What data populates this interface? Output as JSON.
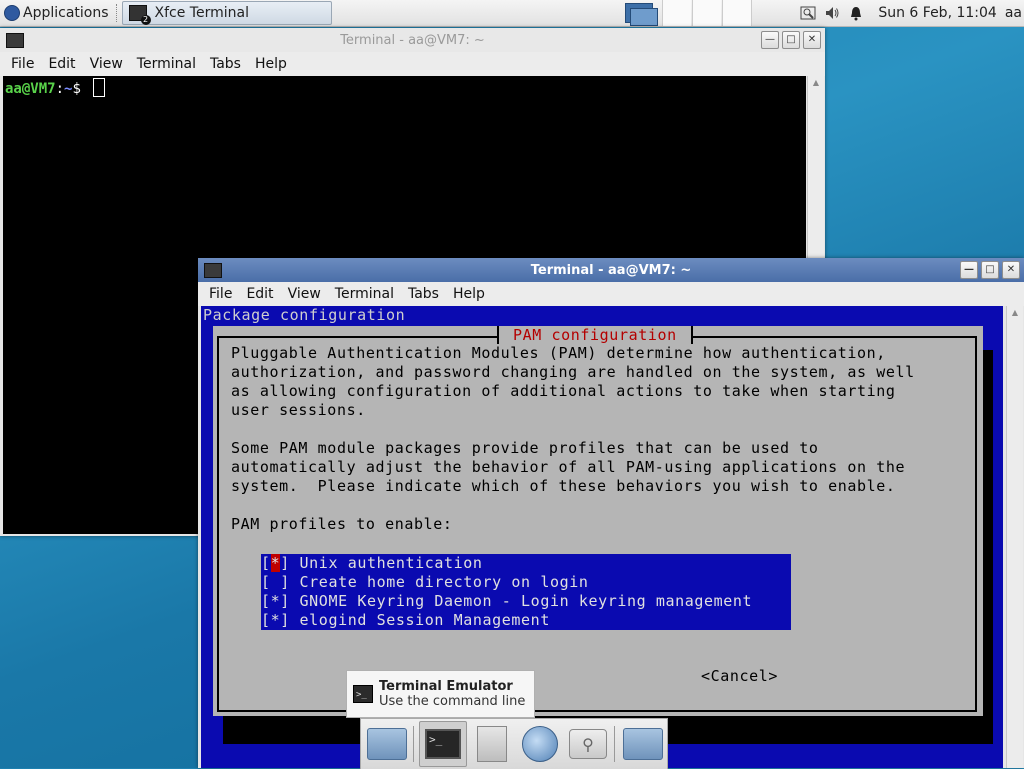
{
  "panel": {
    "applications_label": "Applications",
    "task_label": "Xfce Terminal",
    "task_badge": "2",
    "clock": "Sun  6 Feb, 11:04",
    "user": "aa"
  },
  "window_back": {
    "title": "Terminal - aa@VM7: ~",
    "menu": [
      "File",
      "Edit",
      "View",
      "Terminal",
      "Tabs",
      "Help"
    ],
    "prompt_user": "aa@VM7",
    "prompt_sep": ":",
    "prompt_path": "~",
    "prompt_symbol": "$"
  },
  "window_front": {
    "title": "Terminal - aa@VM7: ~",
    "menu": [
      "File",
      "Edit",
      "View",
      "Terminal",
      "Tabs",
      "Help"
    ],
    "package_config_label": "Package configuration",
    "dialog": {
      "title": "PAM configuration",
      "para1": [
        "Pluggable Authentication Modules (PAM) determine how authentication,",
        "authorization, and password changing are handled on the system, as well",
        "as allowing configuration of additional actions to take when starting",
        "user sessions."
      ],
      "para2": [
        "Some PAM module packages provide profiles that can be used to",
        "automatically adjust the behavior of all PAM-using applications on the",
        "system.  Please indicate which of these behaviors you wish to enable."
      ],
      "prompt": "PAM profiles to enable:",
      "options": [
        {
          "mark": "*",
          "label": "Unix authentication"
        },
        {
          "mark": " ",
          "label": "Create home directory on login"
        },
        {
          "mark": "*",
          "label": "GNOME Keyring Daemon - Login keyring management"
        },
        {
          "mark": "*",
          "label": "elogind Session Management"
        }
      ],
      "cancel_label": "<Cancel>"
    }
  },
  "tooltip": {
    "title": "Terminal Emulator",
    "subtitle": "Use the command line"
  },
  "dock": {
    "items": [
      "home-folder-icon",
      "terminal-icon",
      "file-cabinet-icon",
      "web-browser-icon",
      "app-finder-icon",
      "folder-icon"
    ]
  }
}
